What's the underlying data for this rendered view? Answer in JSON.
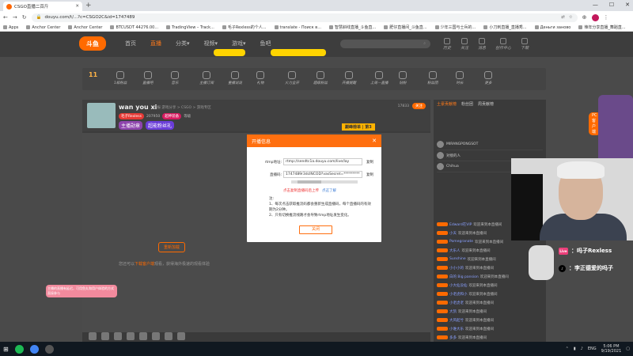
{
  "browser": {
    "tab_title": "CSGO直播二百斤",
    "url": "douyu.com/t/...?c=CSGO2C&id=1747489",
    "new_tab": "+",
    "window_minimize": "—",
    "window_maximize": "☐",
    "window_close": "✕"
  },
  "bookmarks": [
    "Apps",
    "Anchor Center",
    "Anchor Center",
    "BTCUSDT 44276.00...",
    "TradingView – Track...",
    "毛子Rexless的个人...",
    "translate - Поиск в...",
    "智慧斜线直播_斗鱼直...",
    "肥仔直播间_斗鱼直...",
    "少年三国与士兵的...",
    "小刀刺直播_直播秀...",
    "Деньги заново",
    "辣年分享直播_舞蹈直..."
  ],
  "reading_list": "Reading list",
  "site_nav": {
    "logo": "斗鱼",
    "links": [
      "首页",
      "直播",
      "分类▾",
      "视频▾",
      "游戏▾",
      "鱼吧"
    ],
    "search_placeholder": "",
    "icons": [
      "历史",
      "关注",
      "消息",
      "创作中心",
      "下载"
    ]
  },
  "category_bar": {
    "level": "11",
    "items": [
      "1级粉丝",
      "直播吧",
      "音乐",
      "主播订阅",
      "重播说说",
      "礼物",
      "火力全开",
      "超级粉丝",
      "开播提醒",
      "上周一直播",
      "钻粉",
      "粉丝团",
      "时长",
      "更多"
    ],
    "pc_button": "PC客户端"
  },
  "anchor": {
    "name": "wan you xi",
    "meta": "举报  游戏分享 > CSGO > 游戏专区",
    "badges": [
      "毛子Rexless",
      "207950",
      "超神装备",
      "等级"
    ],
    "rank": "巅峰榜单 | 第3",
    "follow": "关注",
    "follow_count": "17833",
    "actions": [
      "分享",
      "手机看",
      "客户端"
    ],
    "tag1": "主播勋章",
    "tag2": "超能粉丝礼"
  },
  "player": {
    "retry": "重新加载",
    "tip_prefix": "您还可以",
    "tip_link": "下载客户端",
    "tip_suffix": "观看，获得海外极速的观看体验",
    "bubble": "主播的直播有延迟，可用鱼丸和用户体验的方式直接参与"
  },
  "chat": {
    "tabs": [
      "土豪贡献榜",
      "粉丝团",
      "周贡献榜"
    ],
    "ranks": [
      "MIRANGPONGSOT",
      "对接的人",
      "Chihua"
    ],
    "danmu": [
      {
        "name": "Edward在VIP",
        "msg": "欢迎来到本直播间"
      },
      {
        "name": "小天",
        "msg": "欢迎来到本直播间"
      },
      {
        "name": "Pomegranate",
        "msg": "欢迎来到本直播间"
      },
      {
        "name": "大乐人",
        "msg": "欢迎来到本直播间"
      },
      {
        "name": "Sunshine",
        "msg": "欢迎来到本直播间"
      },
      {
        "name": "小小小的",
        "msg": "欢迎来到本直播间"
      },
      {
        "name": "白的 Big pansion",
        "msg": "欢迎来到本直播间"
      },
      {
        "name": "小大仙没仙",
        "msg": "欢迎来到本直播间"
      },
      {
        "name": "小老虎和小",
        "msg": "欢迎来到本直播间"
      },
      {
        "name": "小老虎老",
        "msg": "欢迎来到本直播间"
      },
      {
        "name": "大凯",
        "msg": "欢迎来到本直播间"
      },
      {
        "name": "大风起兮",
        "msg": "欢迎来到本直播间"
      },
      {
        "name": "小谁大乐",
        "msg": "欢迎来到本直播间"
      },
      {
        "name": "多多",
        "msg": "欢迎来到本直播间"
      },
      {
        "name": "发发",
        "msg": "欢迎来到本直播间"
      },
      {
        "name": "人人",
        "msg": "欢迎来到本直播间"
      }
    ]
  },
  "modal": {
    "title": "开播信息",
    "close": "✕",
    "rtmp_label": "rtmp地址:",
    "rtmp_value": "rtmp://sendtc1a.douyu.com/live/lay",
    "key_label": "直播码:",
    "key_value": "1747489r3dcINCOD?vasSecret=*********",
    "copy": "复制",
    "warn": "点击复制直播码后上传",
    "warn_link": "点这了解",
    "notes": "注:\n1、每次点击获取推流码都会重新生成直播码，每个直播码的有效期为2分钟。\n2、只有切换推流线路才会导致rtmp地址发生变化。",
    "ok": "关闭"
  },
  "overlay": {
    "social1": "：吗子Rexless",
    "social2": "：李正德爱的吗子",
    "social1_icon": "Live",
    "social2_icon": "♪"
  },
  "taskbar": {
    "lang": "ENG",
    "time": "5:06 PM",
    "date": "9/19/2021"
  }
}
